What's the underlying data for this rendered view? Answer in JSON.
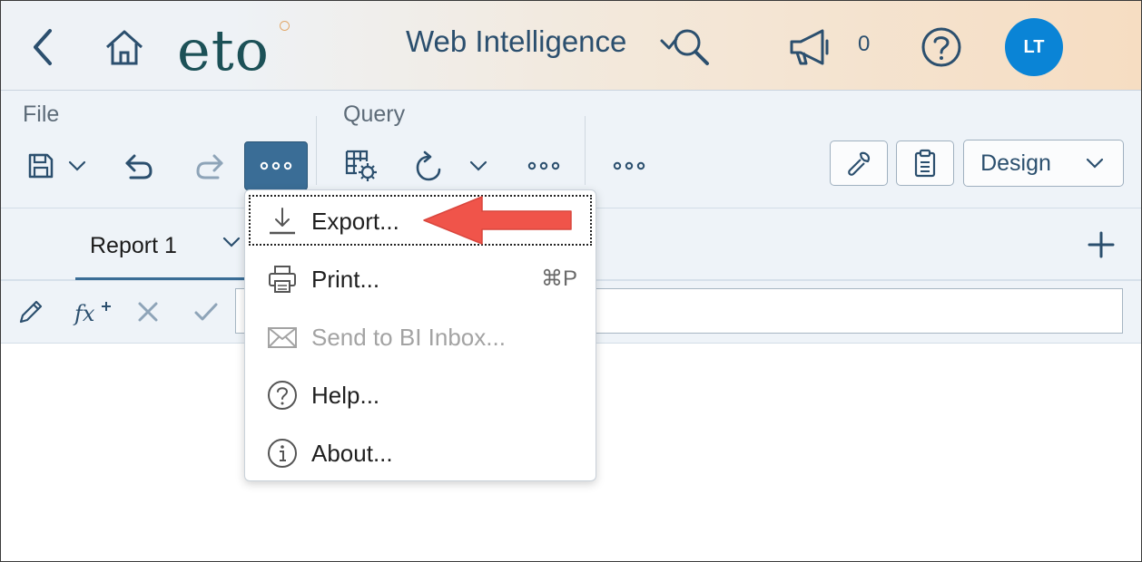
{
  "header": {
    "logo_text": "eto",
    "app_title": "Web Intelligence",
    "notification_count": "0",
    "avatar_initials": "LT",
    "colors": {
      "avatar_bg": "#0a84d6",
      "header_text": "#2b4f6e",
      "logo": "#1c5157"
    }
  },
  "toolbar": {
    "file_group_label": "File",
    "query_group_label": "Query",
    "design_label": "Design",
    "icons": [
      "save-icon",
      "chevron-down-icon",
      "undo-icon",
      "redo-icon",
      "more-icon",
      "query-settings-icon",
      "refresh-icon",
      "more-icon",
      "wrench-icon",
      "clipboard-icon"
    ],
    "colors": {
      "active_button": "#3a6d96"
    }
  },
  "tabs": {
    "items": [
      {
        "label": "Report 1"
      }
    ],
    "add_icon": "plus-icon"
  },
  "formula_bar": {
    "icons": [
      "pencil-icon",
      "function-icon",
      "cancel-icon",
      "check-icon"
    ],
    "value": ""
  },
  "menu": {
    "items": [
      {
        "label": "Export...",
        "icon": "download-icon",
        "shortcut": "",
        "disabled": false,
        "focused": true
      },
      {
        "label": "Print...",
        "icon": "printer-icon",
        "shortcut": "⌘P",
        "disabled": false
      },
      {
        "label": "Send to BI Inbox...",
        "icon": "envelope-icon",
        "shortcut": "",
        "disabled": true
      },
      {
        "label": "Help...",
        "icon": "help-icon",
        "shortcut": "",
        "disabled": false
      },
      {
        "label": "About...",
        "icon": "info-icon",
        "shortcut": "",
        "disabled": false
      }
    ]
  },
  "annotation": {
    "type": "arrow",
    "color": "#f0544a",
    "points_to": "Export..."
  }
}
